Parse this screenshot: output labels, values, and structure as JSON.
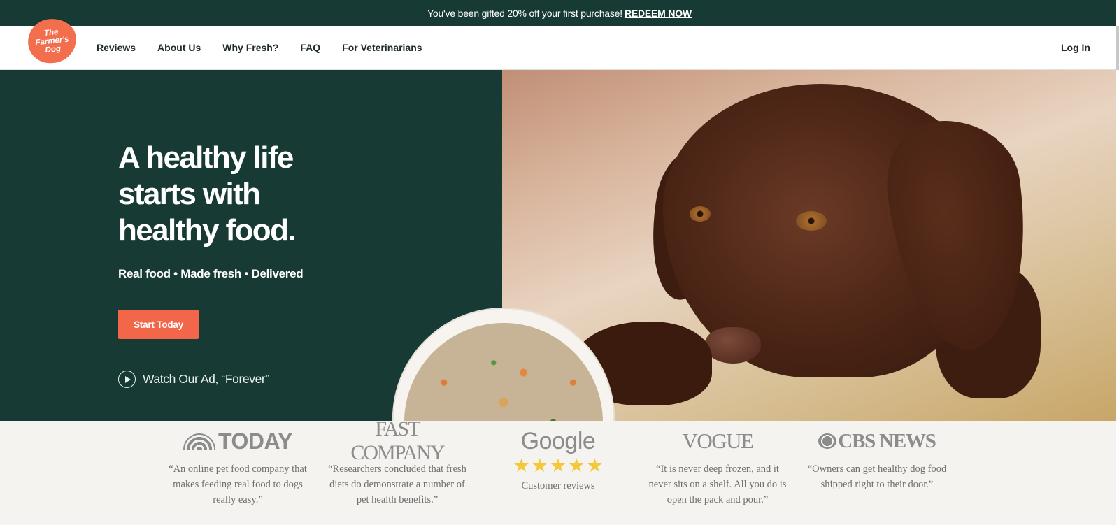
{
  "promo": {
    "text": "You've been gifted 20% off your first purchase!",
    "link": "REDEEM NOW"
  },
  "brand": {
    "logo_text": "The Farmer's Dog",
    "logo_color": "#f26e4c"
  },
  "nav": {
    "items": [
      {
        "label": "Reviews"
      },
      {
        "label": "About Us"
      },
      {
        "label": "Why Fresh?"
      },
      {
        "label": "FAQ"
      },
      {
        "label": "For Veterinarians"
      }
    ],
    "login": "Log In"
  },
  "hero": {
    "headline": "A healthy life starts with healthy food.",
    "subline": "Real food • Made fresh • Delivered",
    "cta": "Start Today",
    "watch": "Watch Our Ad, “Forever”",
    "bg_color": "#173b34",
    "cta_color": "#f2674a"
  },
  "press": [
    {
      "logo": "TODAY",
      "quote": "“An online pet food company that makes feeding real food to dogs really easy.”"
    },
    {
      "logo": "FAST COMPANY",
      "quote": "“Researchers concluded that fresh diets do demonstrate a number of pet health benefits.”"
    },
    {
      "logo": "Google",
      "rating": 5,
      "caption": "Customer reviews"
    },
    {
      "logo": "VOGUE",
      "quote": "“It is never deep frozen, and it never sits on a shelf. All you do is open the pack and pour.”"
    },
    {
      "logo": "CBS NEWS",
      "quote": "“Owners can get healthy dog food shipped right to their door.”"
    }
  ]
}
